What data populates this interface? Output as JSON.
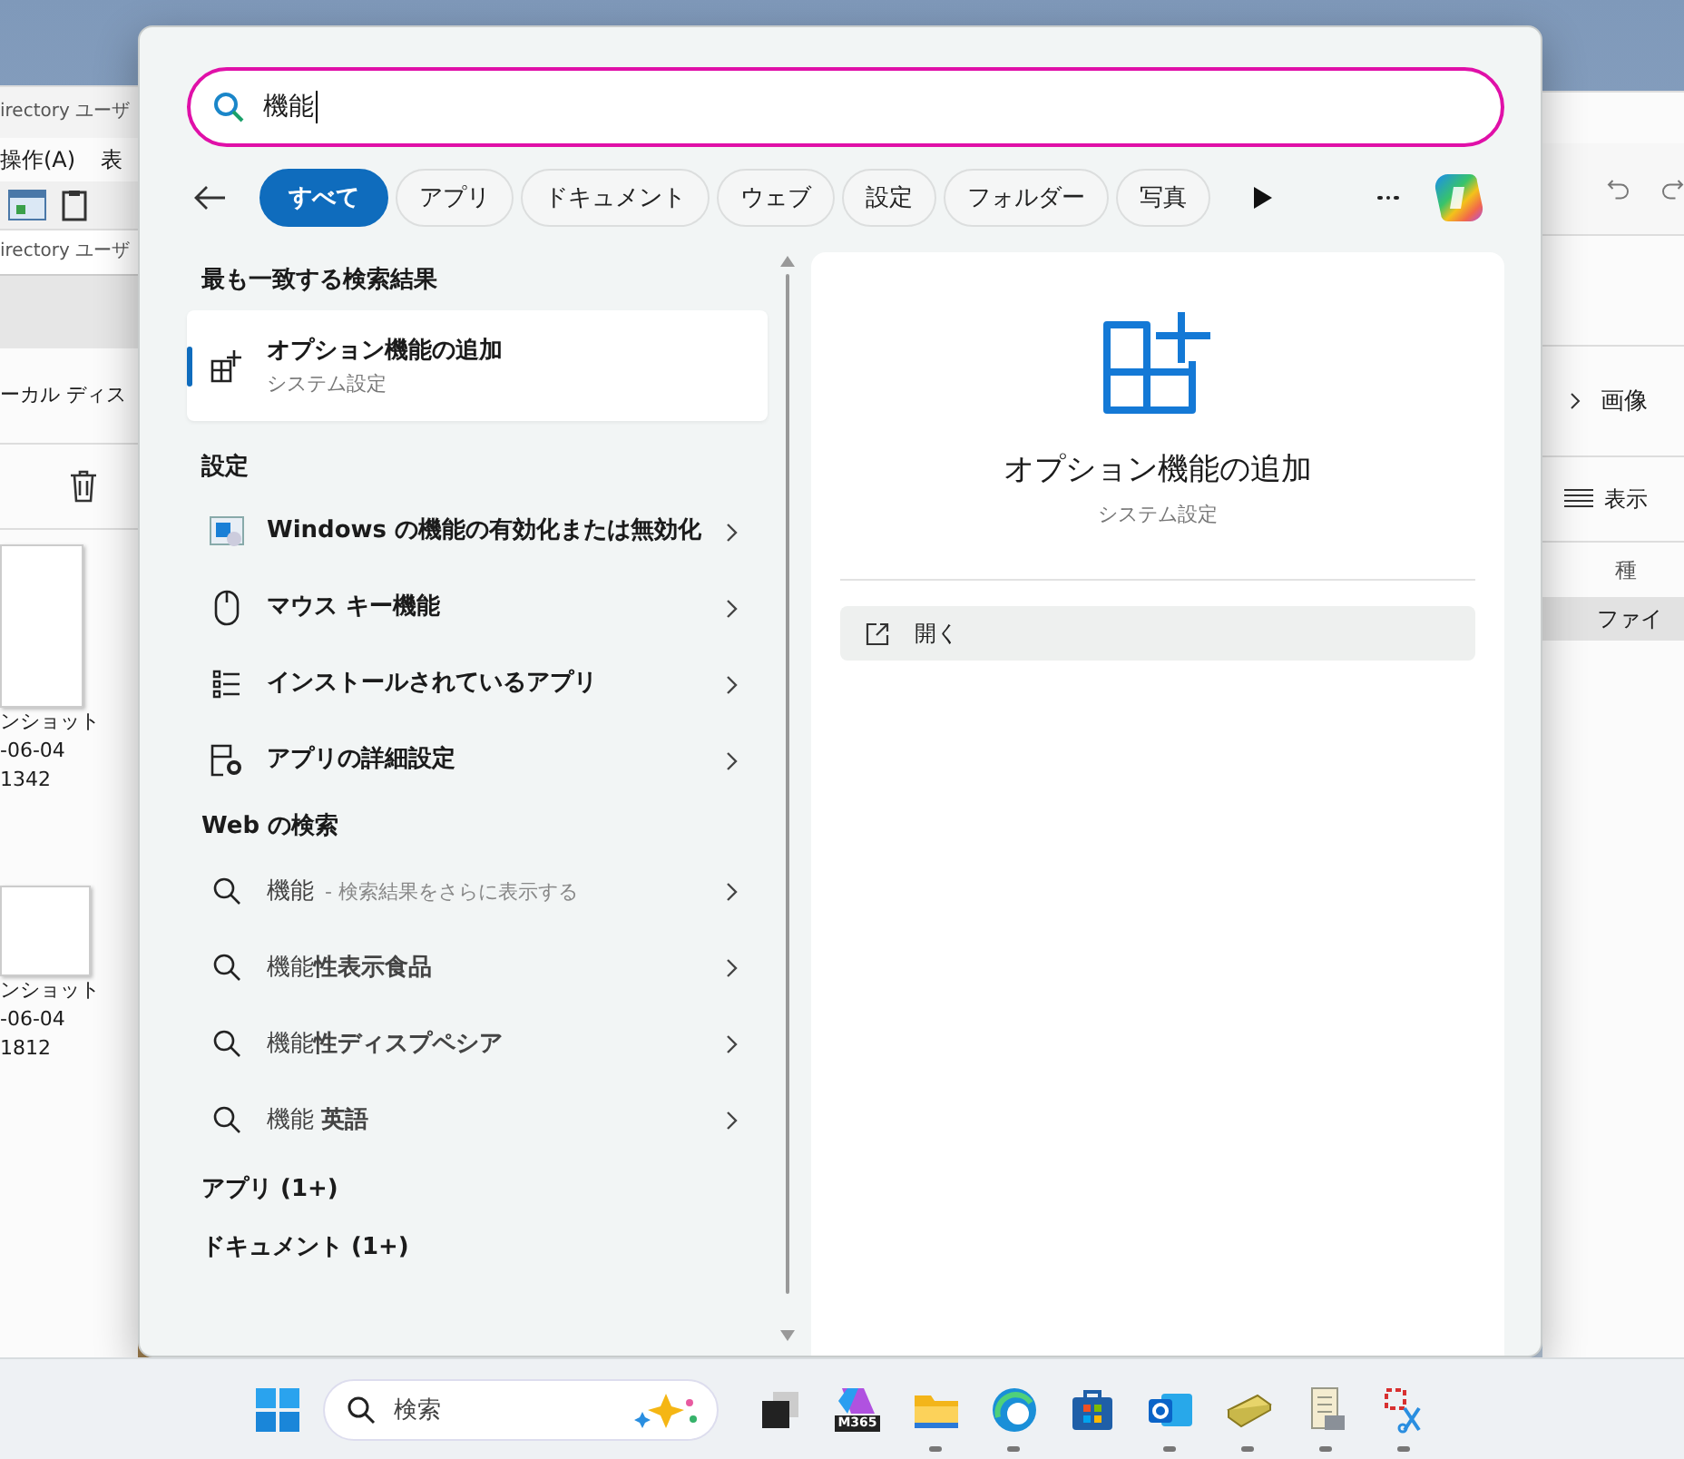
{
  "background_windows": {
    "left": {
      "title": "irectory ユーザ",
      "menu": [
        "操作(A)",
        "表"
      ],
      "address": "irectory ユーザ",
      "location": "ーカル ディス",
      "files": [
        {
          "lines": [
            "ンショット",
            "-06-04",
            "1342"
          ]
        },
        {
          "lines": [
            "ンショット",
            "-06-04",
            "1812"
          ]
        }
      ]
    },
    "right": {
      "breadcrumb": "画像",
      "view_button": "表示",
      "column_header": "種",
      "row_cell": "ファイ"
    }
  },
  "search_panel": {
    "query": "機能",
    "filters": [
      {
        "label": "すべて",
        "selected": true
      },
      {
        "label": "アプリ",
        "selected": false
      },
      {
        "label": "ドキュメント",
        "selected": false
      },
      {
        "label": "ウェブ",
        "selected": false
      },
      {
        "label": "設定",
        "selected": false
      },
      {
        "label": "フォルダー",
        "selected": false
      },
      {
        "label": "写真",
        "selected": false
      }
    ],
    "best_match": {
      "heading": "最も一致する検索結果",
      "title": "オプション機能の追加",
      "subtitle": "システム設定",
      "selected": true
    },
    "settings": {
      "heading": "設定",
      "items": [
        {
          "kind": "windows-features",
          "label": "Windows の機能の有効化または無効化"
        },
        {
          "kind": "mouse",
          "label": "マウス キー機能"
        },
        {
          "kind": "list",
          "label": "インストールされているアプリ"
        },
        {
          "kind": "app-settings",
          "label": "アプリの詳細設定"
        }
      ]
    },
    "web": {
      "heading": "Web の検索",
      "items": [
        {
          "text": "機能",
          "hint": "- 検索結果をさらに表示する"
        },
        {
          "text": "機能**性表示食品**"
        },
        {
          "text": "機能**性ディスプペシア**"
        },
        {
          "text": "機能 **英語**"
        }
      ]
    },
    "more_sections": [
      "アプリ (1+)",
      "ドキュメント (1+)"
    ],
    "preview": {
      "title": "オプション機能の追加",
      "subtitle": "システム設定",
      "action": "開く"
    }
  },
  "taskbar": {
    "search_placeholder": "検索",
    "apps": [
      {
        "kind": "task-view",
        "running": false
      },
      {
        "kind": "m365",
        "label": "M365",
        "running": false
      },
      {
        "kind": "folder",
        "running": true
      },
      {
        "kind": "edge",
        "running": true
      },
      {
        "kind": "store",
        "running": false
      },
      {
        "kind": "outlook",
        "running": true
      },
      {
        "kind": "scanner",
        "running": true
      },
      {
        "kind": "scroll",
        "running": true
      },
      {
        "kind": "snip",
        "running": true
      }
    ]
  }
}
